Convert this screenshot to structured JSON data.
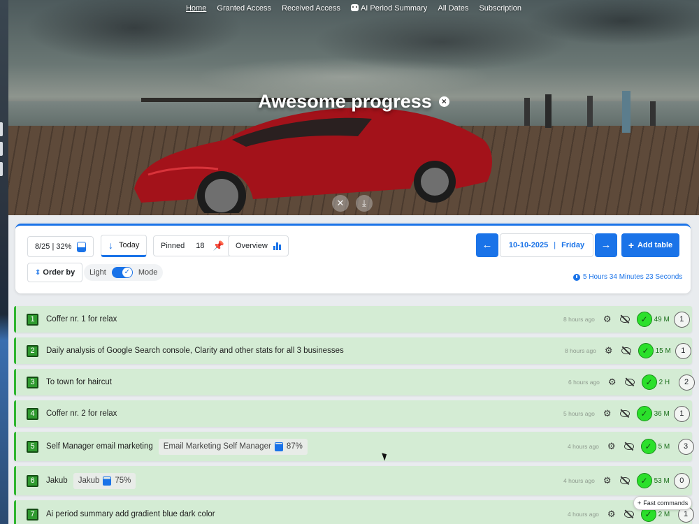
{
  "nav": {
    "items": [
      "Home",
      "Granted Access",
      "Received Access",
      "AI Period Summary",
      "All Dates",
      "Subscription"
    ]
  },
  "hero": {
    "title": "Awesome progress",
    "close_symbol": "×",
    "buttons": [
      "close-icon",
      "download-icon"
    ]
  },
  "toolbar": {
    "progress_label": "8/25 | 32%",
    "today_label": "Today",
    "pinned_label": "Pinned",
    "pinned_count": "18",
    "overview_label": "Overview",
    "date": "10-10-2025",
    "separator": "|",
    "weekday": "Friday",
    "add_table_label": "Add table",
    "order_by_label": "Order by",
    "mode_light": "Light",
    "mode_label": "Mode",
    "timer_text": "5 Hours 34 Minutes 23 Seconds"
  },
  "colors": {
    "accent": "#1a73e8",
    "row_bg": "#d4ecd4",
    "done_green": "#2be02b"
  },
  "tasks": [
    {
      "num": "1",
      "title": "Coffer nr. 1 for relax",
      "ago": "8 hours ago",
      "duration": "49 M",
      "count": "1"
    },
    {
      "num": "2",
      "title": "Daily analysis of Google Search console, Clarity and other stats for all 3 businesses",
      "ago": "8 hours ago",
      "duration": "15 M",
      "count": "1"
    },
    {
      "num": "3",
      "title": "To town for haircut",
      "ago": "6 hours ago",
      "duration": "2 H",
      "count": "2"
    },
    {
      "num": "4",
      "title": "Coffer nr. 2 for relax",
      "ago": "5 hours ago",
      "duration": "36 M",
      "count": "1"
    },
    {
      "num": "5",
      "title": "Self Manager email marketing",
      "tag": "Email Marketing Self Manager",
      "tag_pct": "87%",
      "ago": "4 hours ago",
      "duration": "5 M",
      "count": "3"
    },
    {
      "num": "6",
      "title": "Jakub",
      "tag": "Jakub",
      "tag_pct": "75%",
      "ago": "4 hours ago",
      "duration": "53 M",
      "count": "0"
    },
    {
      "num": "7",
      "title": "Ai period summary add gradient blue dark color",
      "ago": "4 hours ago",
      "duration": "2 M",
      "count": "1"
    }
  ],
  "fast_commands_label": "Fast commands"
}
